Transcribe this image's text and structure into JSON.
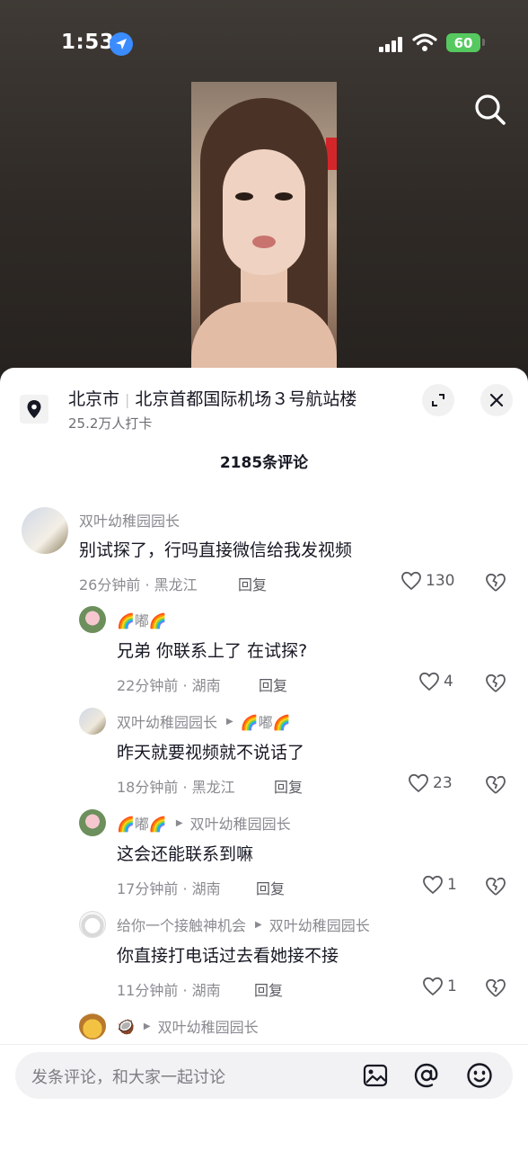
{
  "status": {
    "time": "1:53",
    "battery": "60"
  },
  "location": {
    "city": "北京市",
    "place": "北京首都国际机场３号航站楼",
    "checkins": "25.2万人打卡"
  },
  "comments_header": "2185条评论",
  "comments": [
    {
      "user": "双叶幼稚园园长",
      "reply_to": "",
      "text": "别试探了，行吗直接微信给我发视频",
      "time_loc": "26分钟前 · 黑龙江",
      "reply_label": "回复",
      "likes": "130"
    },
    {
      "user": "🌈嘟🌈",
      "reply_to": "",
      "text": "兄弟 你联系上了 在试探?",
      "time_loc": "22分钟前 · 湖南",
      "reply_label": "回复",
      "likes": "4"
    },
    {
      "user": "双叶幼稚园园长",
      "reply_to": "🌈嘟🌈",
      "text": "昨天就要视频就不说话了",
      "time_loc": "18分钟前 · 黑龙江",
      "reply_label": "回复",
      "likes": "23"
    },
    {
      "user": "🌈嘟🌈",
      "reply_to": "双叶幼稚园园长",
      "text": "这会还能联系到嘛",
      "time_loc": "17分钟前 · 湖南",
      "reply_label": "回复",
      "likes": "1"
    },
    {
      "user": "给你一个接触神机会",
      "reply_to": "双叶幼稚园园长",
      "text": "你直接打电话过去看她接不接",
      "time_loc": "11分钟前 · 湖南",
      "reply_label": "回复",
      "likes": "1"
    },
    {
      "user": "🥥",
      "reply_to": "双叶幼稚园园长"
    }
  ],
  "input": {
    "placeholder": "发条评论，和大家一起讨论"
  },
  "colors": {
    "accent": "#3a8cff",
    "battery": "#55c95f",
    "text": "#161823",
    "muted": "#8a8b91"
  }
}
